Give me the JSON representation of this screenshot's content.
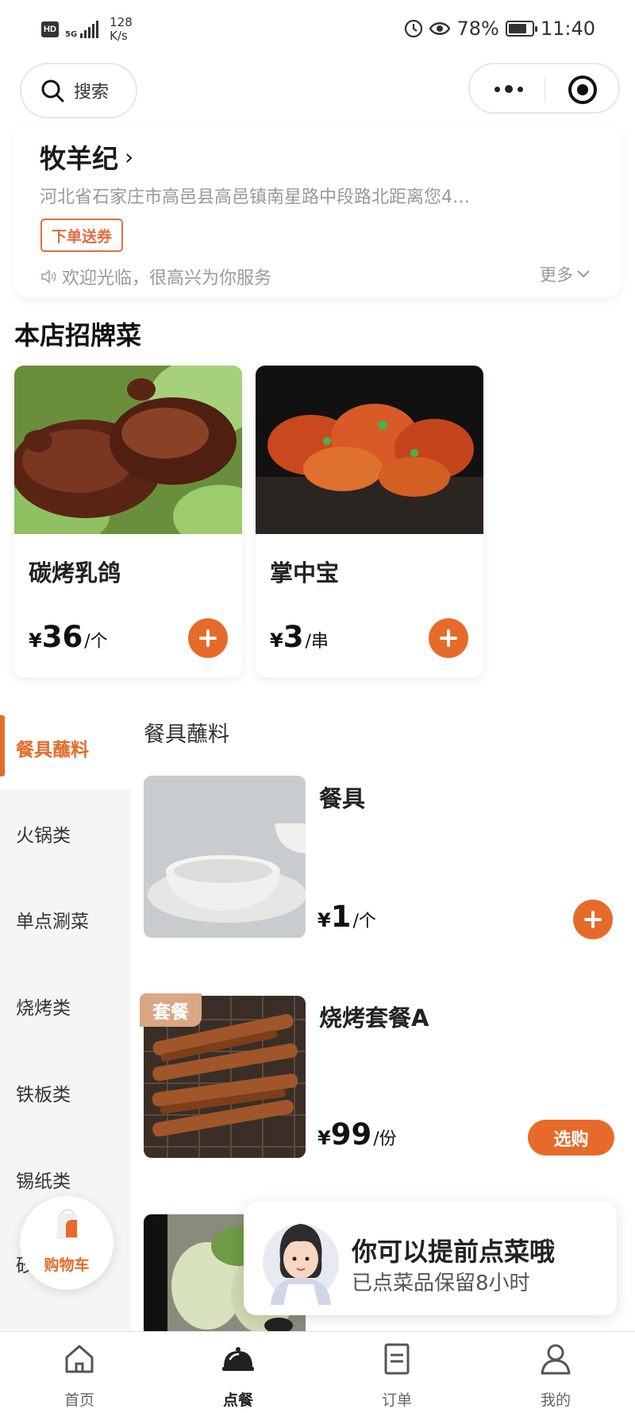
{
  "status_bar": {
    "hd": "HD",
    "network": "5G",
    "speed_value": "128",
    "speed_unit": "K/s",
    "battery": "78%",
    "time": "11:40"
  },
  "header": {
    "search_label": "搜索"
  },
  "store": {
    "name": "牧羊纪",
    "address": "河北省石家庄市高邑县高邑镇南星路中段路北距离您4…",
    "coupon_tag": "下单送券",
    "welcome": "欢迎光临，很高兴为你服务",
    "more": "更多"
  },
  "signature": {
    "title": "本店招牌菜",
    "dishes": [
      {
        "name": "碳烤乳鸽",
        "currency": "¥",
        "price": "36",
        "unit": "/个"
      },
      {
        "name": "掌中宝",
        "currency": "¥",
        "price": "3",
        "unit": "/串"
      }
    ]
  },
  "categories": [
    "餐具蘸料",
    "火锅类",
    "单点涮菜",
    "烧烤类",
    "铁板类",
    "锡纸类",
    "砂"
  ],
  "menu": {
    "section_title": "餐具蘸料",
    "items": [
      {
        "name": "餐具",
        "currency": "¥",
        "price": "1",
        "unit": "/个"
      },
      {
        "name": "烧烤套餐A",
        "badge": "套餐",
        "currency": "¥",
        "price": "99",
        "unit": "/份",
        "action": "选购"
      }
    ]
  },
  "cart": {
    "label": "购物车"
  },
  "tip": {
    "title": "你可以提前点菜哦",
    "subtitle": "已点菜品保留8小时"
  },
  "tabbar": {
    "tabs": [
      {
        "label": "首页",
        "icon": "home-icon"
      },
      {
        "label": "点餐",
        "icon": "cloche-icon"
      },
      {
        "label": "订单",
        "icon": "order-icon"
      },
      {
        "label": "我的",
        "icon": "profile-icon"
      }
    ],
    "active": "点餐"
  },
  "colors": {
    "accent": "#e66b2a",
    "combo_badge": "#d9a784",
    "muted_text": "#999999"
  }
}
